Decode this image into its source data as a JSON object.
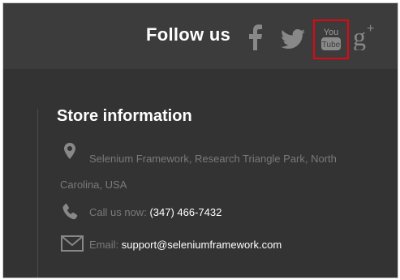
{
  "header": {
    "title": "Follow us",
    "social": [
      {
        "name": "facebook-icon",
        "label": "f"
      },
      {
        "name": "twitter-icon",
        "label": ""
      },
      {
        "name": "youtube-icon",
        "label_top": "You",
        "label_bottom": "Tube",
        "highlighted": true
      },
      {
        "name": "google-plus-icon",
        "label": "g+"
      }
    ]
  },
  "store": {
    "title": "Store information",
    "address": "Selenium Framework, Research Triangle Park, North Carolina, USA",
    "phone_label": "Call us now:",
    "phone": "(347) 466-7432",
    "email_label": "Email:",
    "email": "support@seleniumframework.com"
  },
  "colors": {
    "background": "#333333",
    "header_background": "#3c3c3c",
    "muted_text": "#7a7a7a",
    "icon_gray": "#888888",
    "highlight_border": "#e30613"
  }
}
